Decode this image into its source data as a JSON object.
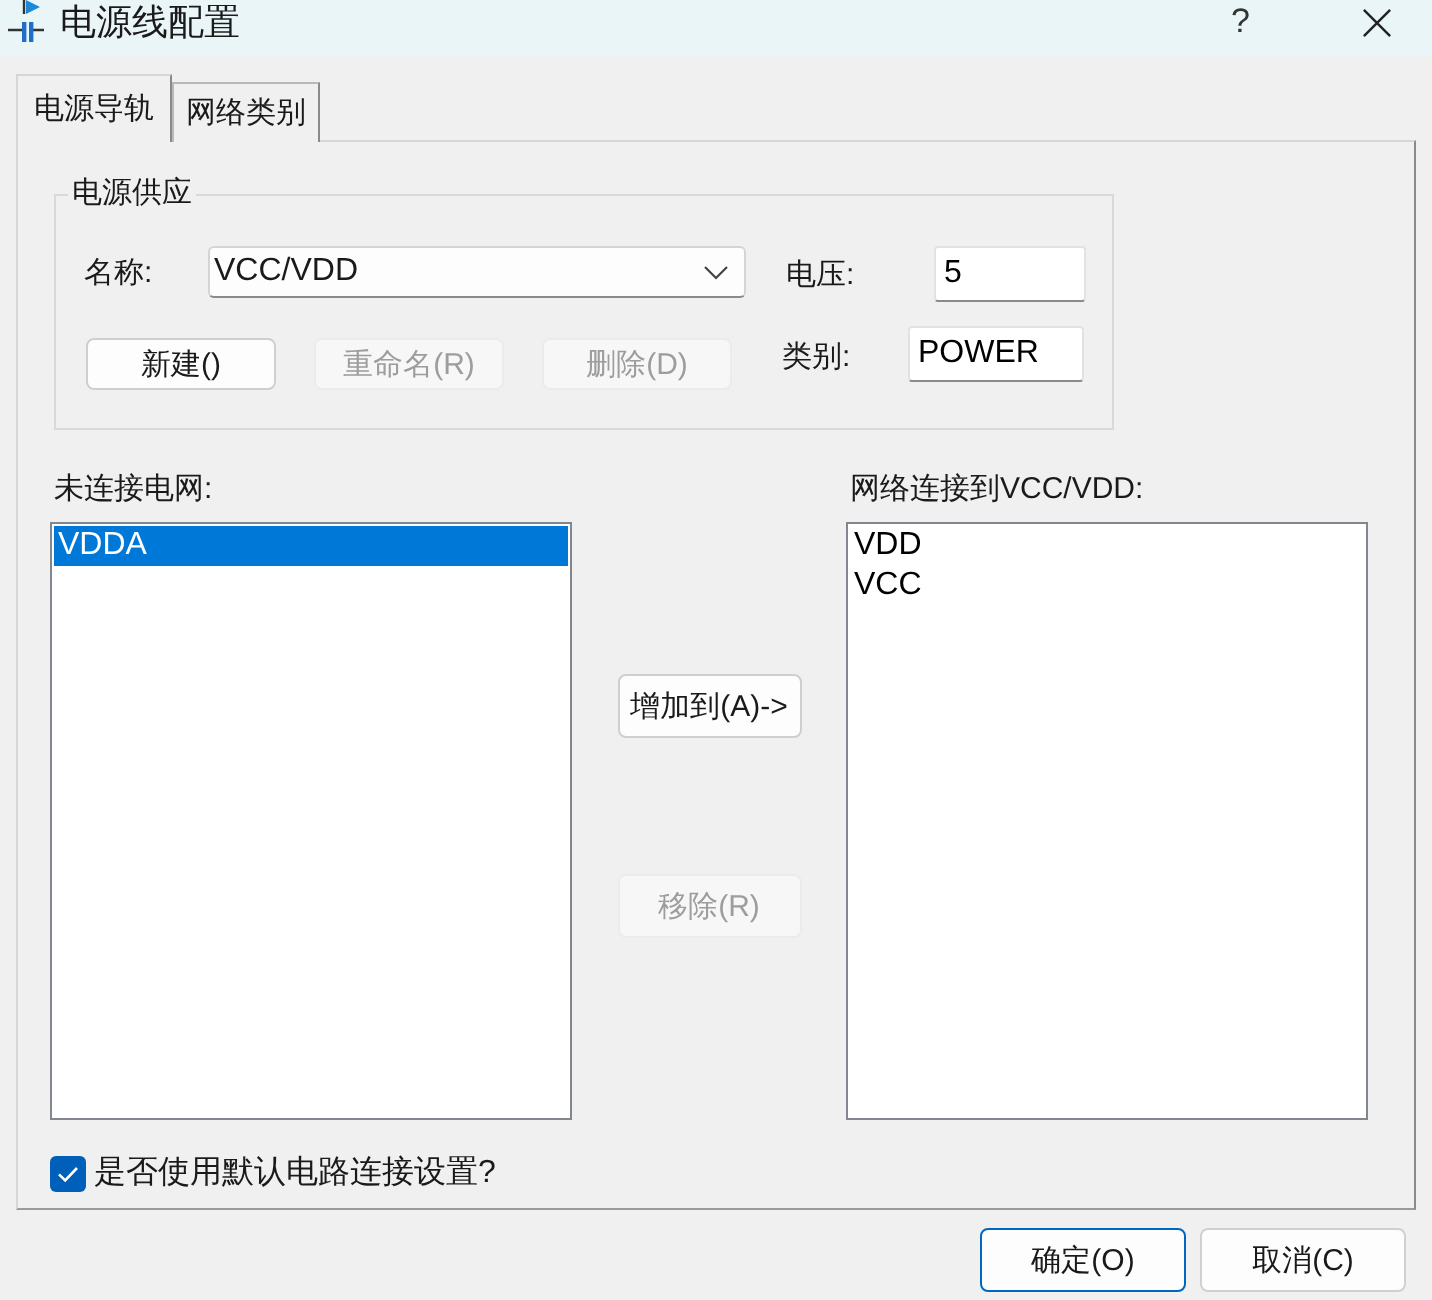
{
  "window": {
    "title": "电源线配置",
    "help": "?"
  },
  "tabs": [
    {
      "label": "电源导轨",
      "selected": true
    },
    {
      "label": "网络类别",
      "selected": false
    }
  ],
  "power_supply": {
    "title": "电源供应",
    "name_label": "名称:",
    "name_value": "VCC/VDD",
    "voltage_label": "电压:",
    "voltage_value": "5",
    "class_label": "类别:",
    "class_value": "POWER",
    "buttons": [
      {
        "label": "新建()",
        "disabled": false
      },
      {
        "label": "重命名(R)",
        "disabled": true
      },
      {
        "label": "删除(D)",
        "disabled": true
      }
    ]
  },
  "unconnected": {
    "label": "未连接电网:",
    "items": [
      {
        "text": "VDDA",
        "selected": true
      }
    ]
  },
  "transfer_buttons": [
    {
      "label": "增加到(A)->",
      "disabled": false
    },
    {
      "label": "移除(R)",
      "disabled": true
    }
  ],
  "connected": {
    "label": "网络连接到VCC/VDD:",
    "items": [
      {
        "text": "VDD",
        "selected": false
      },
      {
        "text": "VCC",
        "selected": false
      }
    ]
  },
  "default_setting": {
    "label": "是否使用默认电路连接设置?",
    "checked": true
  },
  "footer_buttons": [
    {
      "label": "确定(O)",
      "default": true
    },
    {
      "label": "取消(C)",
      "default": false
    }
  ]
}
